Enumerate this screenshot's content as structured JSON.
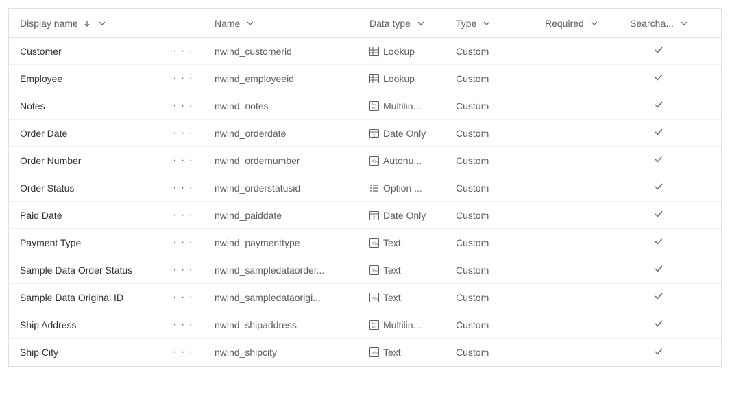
{
  "columns": {
    "display_name": "Display name",
    "name": "Name",
    "data_type": "Data type",
    "type": "Type",
    "required": "Required",
    "searchable": "Searcha..."
  },
  "rows": [
    {
      "display": "Customer",
      "name": "nwind_customerid",
      "data_type": "Lookup",
      "icon": "lookup",
      "type": "Custom",
      "required": "",
      "searchable": true
    },
    {
      "display": "Employee",
      "name": "nwind_employeeid",
      "data_type": "Lookup",
      "icon": "lookup",
      "type": "Custom",
      "required": "",
      "searchable": true
    },
    {
      "display": "Notes",
      "name": "nwind_notes",
      "data_type": "Multilin...",
      "icon": "multiline",
      "type": "Custom",
      "required": "",
      "searchable": true
    },
    {
      "display": "Order Date",
      "name": "nwind_orderdate",
      "data_type": "Date Only",
      "icon": "date",
      "type": "Custom",
      "required": "",
      "searchable": true
    },
    {
      "display": "Order Number",
      "name": "nwind_ordernumber",
      "data_type": "Autonu...",
      "icon": "autonum",
      "type": "Custom",
      "required": "",
      "searchable": true
    },
    {
      "display": "Order Status",
      "name": "nwind_orderstatusid",
      "data_type": "Option ...",
      "icon": "option",
      "type": "Custom",
      "required": "",
      "searchable": true
    },
    {
      "display": "Paid Date",
      "name": "nwind_paiddate",
      "data_type": "Date Only",
      "icon": "date",
      "type": "Custom",
      "required": "",
      "searchable": true
    },
    {
      "display": "Payment Type",
      "name": "nwind_paymenttype",
      "data_type": "Text",
      "icon": "text",
      "type": "Custom",
      "required": "",
      "searchable": true
    },
    {
      "display": "Sample Data Order Status",
      "name": "nwind_sampledataorder...",
      "data_type": "Text",
      "icon": "text",
      "type": "Custom",
      "required": "",
      "searchable": true
    },
    {
      "display": "Sample Data Original ID",
      "name": "nwind_sampledataorigi...",
      "data_type": "Text",
      "icon": "text",
      "type": "Custom",
      "required": "",
      "searchable": true
    },
    {
      "display": "Ship Address",
      "name": "nwind_shipaddress",
      "data_type": "Multilin...",
      "icon": "multiline",
      "type": "Custom",
      "required": "",
      "searchable": true
    },
    {
      "display": "Ship City",
      "name": "nwind_shipcity",
      "data_type": "Text",
      "icon": "text",
      "type": "Custom",
      "required": "",
      "searchable": true
    }
  ]
}
